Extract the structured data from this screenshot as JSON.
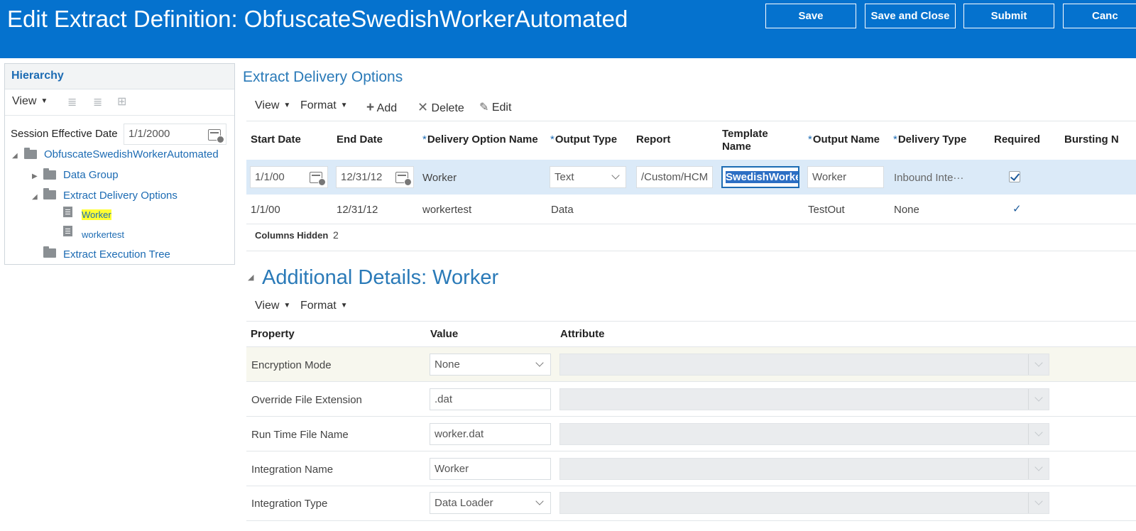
{
  "header": {
    "title": "Edit Extract Definition: ObfuscateSwedishWorkerAutomated",
    "buttons": {
      "save": "Save",
      "save_close": "Save and Close",
      "submit": "Submit",
      "cancel": "Canc"
    }
  },
  "hierarchy": {
    "title": "Hierarchy",
    "view_label": "View",
    "session_label": "Session Effective Date",
    "session_value": "1/1/2000",
    "tree": {
      "root": "ObfuscateSwedishWorkerAutomated",
      "data_group": "Data Group",
      "extract_delivery_options": "Extract Delivery Options",
      "worker": "Worker",
      "workertest": "workertest",
      "extract_execution_tree": "Extract Execution Tree"
    }
  },
  "delivery": {
    "title": "Extract Delivery Options",
    "toolbar": {
      "view": "View",
      "format": "Format",
      "add": "Add",
      "delete": "Delete",
      "edit": "Edit"
    },
    "columns": {
      "start_date": "Start Date",
      "end_date": "End Date",
      "delivery_option_name": "Delivery Option Name",
      "output_type": "Output Type",
      "report": "Report",
      "template_name_1": "Template",
      "template_name_2": "Name",
      "output_name": "Output Name",
      "delivery_type": "Delivery Type",
      "required": "Required",
      "bursting": "Bursting N"
    },
    "rows": [
      {
        "start_date": "1/1/00",
        "end_date": "12/31/12",
        "delivery_option_name": "Worker",
        "output_type": "Text",
        "report": "/Custom/HCM",
        "template_name": "SwedishWorker",
        "output_name": "Worker",
        "delivery_type": "Inbound Inte···",
        "required": true
      },
      {
        "start_date": "1/1/00",
        "end_date": "12/31/12",
        "delivery_option_name": "workertest",
        "output_type": "Data",
        "report": "",
        "template_name": "",
        "output_name": "TestOut",
        "delivery_type": "None",
        "required": true
      }
    ],
    "columns_hidden_label": "Columns Hidden",
    "columns_hidden_value": "2"
  },
  "details": {
    "title": "Additional Details: Worker",
    "toolbar": {
      "view": "View",
      "format": "Format"
    },
    "columns": {
      "property": "Property",
      "value": "Value",
      "attribute": "Attribute"
    },
    "rows": [
      {
        "property": "Encryption Mode",
        "value": "None"
      },
      {
        "property": "Override File Extension",
        "value": ".dat"
      },
      {
        "property": "Run Time File Name",
        "value": "worker.dat"
      },
      {
        "property": "Integration Name",
        "value": "Worker"
      },
      {
        "property": "Integration Type",
        "value": "Data Loader"
      }
    ]
  },
  "colors": {
    "header_bg": "#0572ce",
    "link_blue": "#1c6bb3",
    "selected_row": "#dbeaf8",
    "highlight": "#ffff33"
  }
}
